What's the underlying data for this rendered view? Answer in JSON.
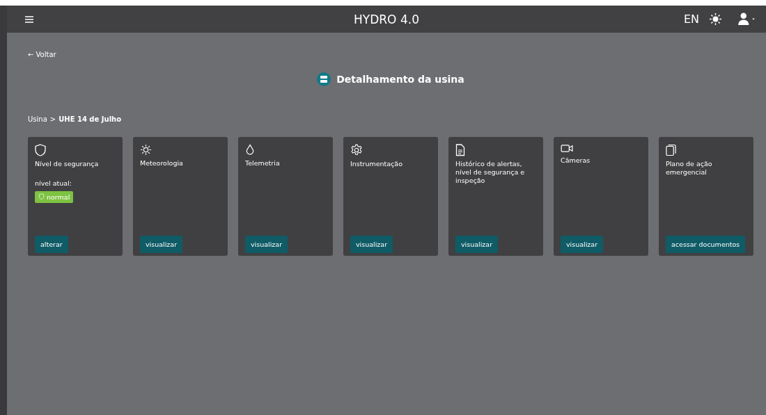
{
  "header": {
    "title": "HYDRO 4.0",
    "language": "EN"
  },
  "back_link": "← Voltar",
  "page_title": "Detalhamento da usina",
  "breadcrumb": {
    "parent": "Usina",
    "separator": ">",
    "current": "UHE 14 de Julho"
  },
  "cards": [
    {
      "kind": "shield",
      "title": "Nível de segurança",
      "status": {
        "label": "nível atual:",
        "value": "normal",
        "color": "#7dc242"
      },
      "button": "alterar"
    },
    {
      "kind": "sun",
      "title": "Meteorologia",
      "button": "visualizar"
    },
    {
      "kind": "drop",
      "title": "Telemetria",
      "button": "visualizar"
    },
    {
      "kind": "gear",
      "title": "Instrumentação",
      "button": "visualizar"
    },
    {
      "kind": "document",
      "title": "Histórico de alertas, nível de segurança e inspeção",
      "button": "visualizar"
    },
    {
      "kind": "camera",
      "title": "Câmeras",
      "button": "visualizar"
    },
    {
      "kind": "copy",
      "title": "Plano de ação emergencial",
      "button": "acessar documentos"
    }
  ]
}
